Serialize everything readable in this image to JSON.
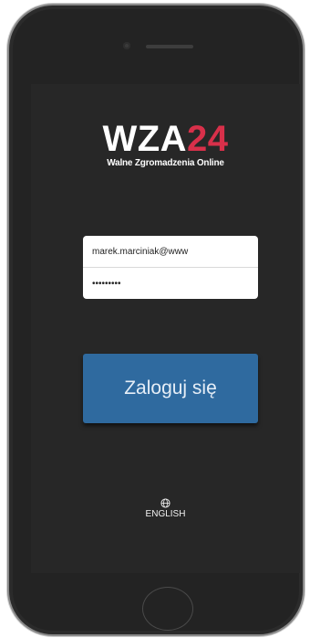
{
  "logo": {
    "text_white": "WZA",
    "text_red": "24",
    "subtitle": "Walne Zgromadzenia Online",
    "colors": {
      "white": "#ffffff",
      "red": "#d8304a"
    }
  },
  "form": {
    "username_value": "marek.marciniak@www",
    "password_value": "•••••••••"
  },
  "login_button": {
    "label": "Zaloguj się",
    "color": "#2f6a9f"
  },
  "language": {
    "icon": "globe-icon",
    "label": "ENGLISH"
  },
  "colors": {
    "screen_background": "#272727",
    "phone_body": "#2b2b2b"
  }
}
